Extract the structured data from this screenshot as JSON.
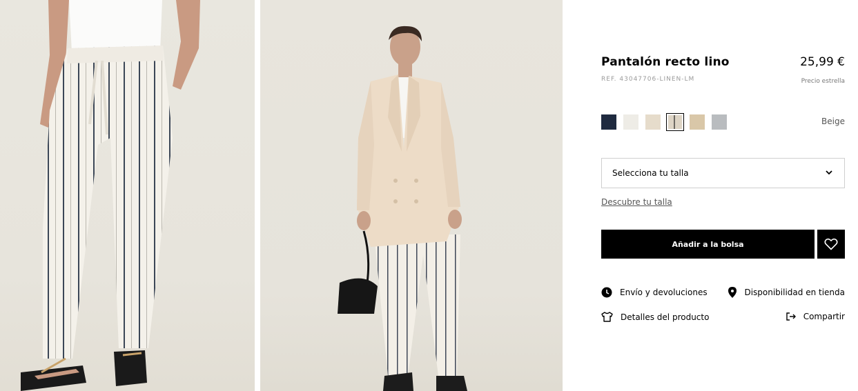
{
  "images": [
    {
      "name": "product-photo-detail"
    },
    {
      "name": "product-photo-model"
    }
  ],
  "product": {
    "title": "Pantalón recto lino",
    "price": "25,99 €",
    "ref": "REF. 43047706-LINEN-LM",
    "price_note": "Precio estrella"
  },
  "colors": {
    "swatches": [
      {
        "name": "navy",
        "color": "#1f2a3f"
      },
      {
        "name": "off-white",
        "color": "#eeece6"
      },
      {
        "name": "cream",
        "color": "#e6dccb"
      },
      {
        "name": "beige-stripe",
        "color": "#d8cfc1",
        "selected": true
      },
      {
        "name": "sand",
        "color": "#d9c7a8"
      },
      {
        "name": "grey",
        "color": "#b9bcbf"
      }
    ],
    "selected_name": "Beige"
  },
  "size": {
    "placeholder": "Selecciona tu talla",
    "guide_link": "Descubre tu talla"
  },
  "actions": {
    "add_to_bag": "Añadir a la bolsa",
    "wishlist_icon": "heart-icon"
  },
  "info_links": {
    "shipping": "Envío y devoluciones",
    "store_availability": "Disponibilidad en tienda",
    "product_details": "Detalles del producto",
    "share": "Compartir"
  }
}
